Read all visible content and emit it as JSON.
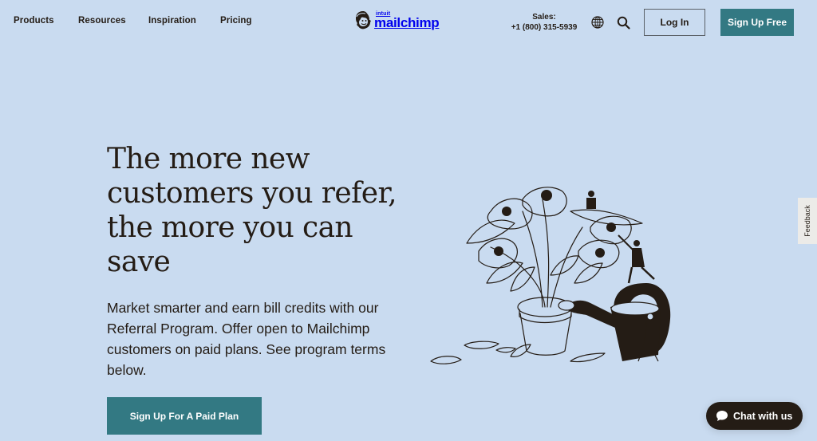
{
  "header": {
    "nav": [
      {
        "label": "Products"
      },
      {
        "label": "Resources"
      },
      {
        "label": "Inspiration"
      },
      {
        "label": "Pricing"
      }
    ],
    "logo": {
      "parent_brand": "intuit",
      "brand": "mailchimp",
      "icon": "freddie-chimp-icon"
    },
    "sales": {
      "label": "Sales:",
      "phone": "+1 (800) 315-5939"
    },
    "icons": {
      "globe": "globe-icon",
      "search": "search-icon"
    },
    "login_label": "Log In",
    "signup_label": "Sign Up Free"
  },
  "hero": {
    "title": "The more new customers you refer, the more you can save",
    "body": "Market smarter and earn bill credits with our Referral Program. Offer open to Mailchimp customers on paid plans. See program terms below.",
    "cta_label": "Sign Up For A Paid Plan",
    "illustration": "plant-watering-can-illustration"
  },
  "feedback": {
    "label": "Feedback"
  },
  "chat": {
    "label": "Chat with us",
    "icon": "chat-bubble-icon"
  },
  "colors": {
    "background": "#c9dbf0",
    "primary_button": "#337983",
    "text": "#241c15",
    "chat_bg": "#241c15"
  }
}
